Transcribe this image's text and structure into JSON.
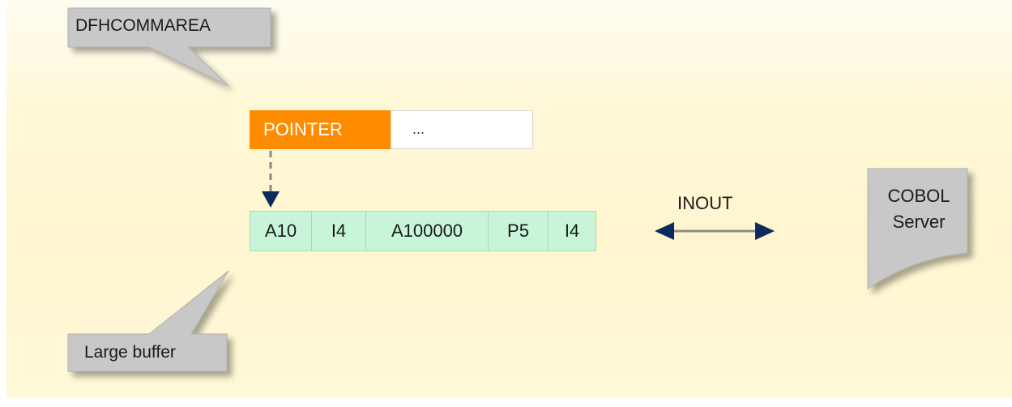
{
  "callouts": {
    "top": "DFHCOMMAREA",
    "bottom": "Large buffer"
  },
  "commarea": {
    "pointer_label": "POINTER",
    "rest_label": "..."
  },
  "buffer_fields": [
    "A10",
    "I4",
    "A100000",
    "P5",
    "I4"
  ],
  "direction_label": "INOUT",
  "server": {
    "line1": "COBOL",
    "line2": "Server"
  },
  "colors": {
    "background": "#fff6d0",
    "pointer": "#ff8c00",
    "buffer": "#c8f4d8",
    "callout": "#c8c8c8",
    "arrow": "#0d2a5c"
  }
}
